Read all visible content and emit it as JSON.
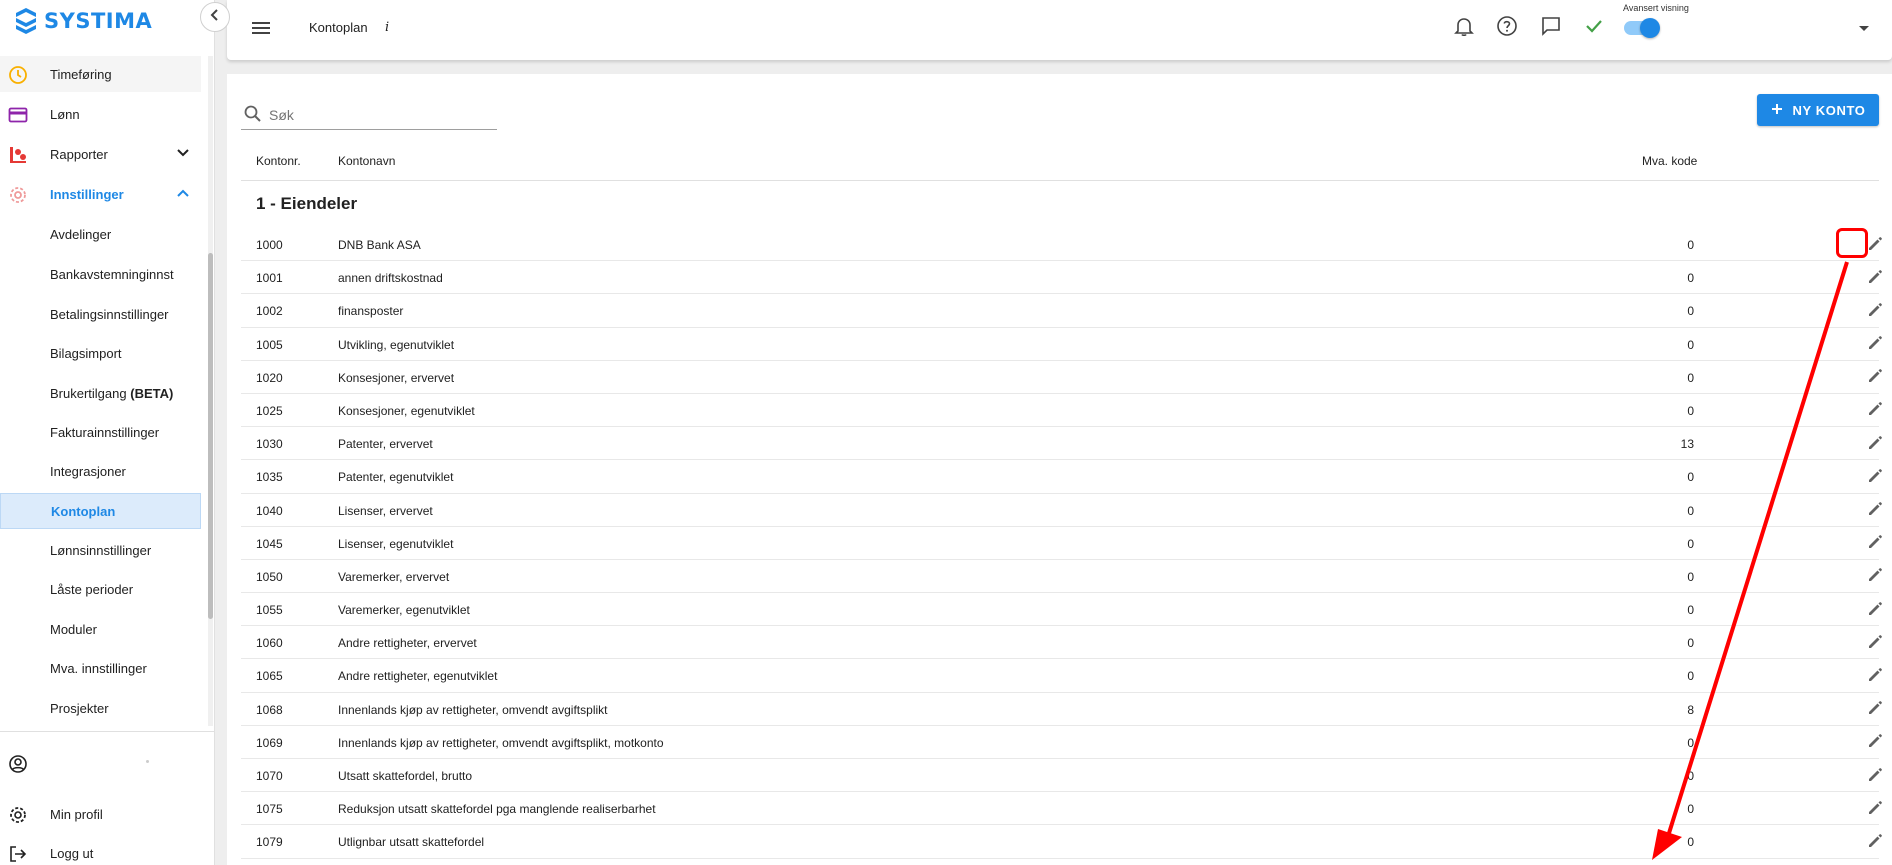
{
  "brand": {
    "name": "SYSTIMA",
    "accent": "#1e88e5"
  },
  "sidebar": {
    "items": [
      {
        "label": "Timeføring",
        "icon": "clock-icon"
      },
      {
        "label": "Lønn",
        "icon": "payment-card-icon"
      },
      {
        "label": "Rapporter",
        "icon": "report-chart-icon"
      },
      {
        "label": "Innstillinger",
        "icon": "settings-gear-icon"
      }
    ],
    "subitems": [
      {
        "label": "Avdelinger"
      },
      {
        "label": "Bankavstemninginnst"
      },
      {
        "label": "Betalingsinnstillinger"
      },
      {
        "label": "Bilagsimport"
      },
      {
        "label": "Brukertilgang",
        "badge": "(BETA)"
      },
      {
        "label": "Fakturainnstillinger"
      },
      {
        "label": "Integrasjoner"
      },
      {
        "label": "Kontoplan"
      },
      {
        "label": "Lønnsinnstillinger"
      },
      {
        "label": "Låste perioder"
      },
      {
        "label": "Moduler"
      },
      {
        "label": "Mva. innstillinger"
      },
      {
        "label": "Prosjekter"
      }
    ],
    "bottom": [
      {
        "label": "",
        "icon": "account-circle-icon"
      },
      {
        "label": "Min profil",
        "icon": "gear-icon"
      },
      {
        "label": "Logg ut",
        "icon": "logout-icon"
      }
    ]
  },
  "header": {
    "title": "Kontoplan",
    "info": "i",
    "advanced_label": "Avansert visning",
    "advanced_on": true
  },
  "toolbar": {
    "search_placeholder": "Søk",
    "new_button": "NY KONTO"
  },
  "table": {
    "columns": {
      "nr": "Kontonr.",
      "name": "Kontonavn",
      "mva": "Mva. kode"
    },
    "group": "1 - Eiendeler",
    "rows": [
      {
        "nr": "1000",
        "name": "DNB Bank ASA",
        "mva": "0"
      },
      {
        "nr": "1001",
        "name": "annen driftskostnad",
        "mva": "0"
      },
      {
        "nr": "1002",
        "name": "finansposter",
        "mva": "0"
      },
      {
        "nr": "1005",
        "name": "Utvikling, egenutviklet",
        "mva": "0"
      },
      {
        "nr": "1020",
        "name": "Konsesjoner, ervervet",
        "mva": "0"
      },
      {
        "nr": "1025",
        "name": "Konsesjoner, egenutviklet",
        "mva": "0"
      },
      {
        "nr": "1030",
        "name": "Patenter, ervervet",
        "mva": "13"
      },
      {
        "nr": "1035",
        "name": "Patenter, egenutviklet",
        "mva": "0"
      },
      {
        "nr": "1040",
        "name": "Lisenser, ervervet",
        "mva": "0"
      },
      {
        "nr": "1045",
        "name": "Lisenser, egenutviklet",
        "mva": "0"
      },
      {
        "nr": "1050",
        "name": "Varemerker, ervervet",
        "mva": "0"
      },
      {
        "nr": "1055",
        "name": "Varemerker, egenutviklet",
        "mva": "0"
      },
      {
        "nr": "1060",
        "name": "Andre rettigheter, ervervet",
        "mva": "0"
      },
      {
        "nr": "1065",
        "name": "Andre rettigheter, egenutviklet",
        "mva": "0"
      },
      {
        "nr": "1068",
        "name": "Innenlands kjøp av rettigheter, omvendt avgiftsplikt",
        "mva": "8"
      },
      {
        "nr": "1069",
        "name": "Innenlands kjøp av rettigheter, omvendt avgiftsplikt, motkonto",
        "mva": "0"
      },
      {
        "nr": "1070",
        "name": "Utsatt skattefordel, brutto",
        "mva": "0"
      },
      {
        "nr": "1075",
        "name": "Reduksjon utsatt skattefordel pga manglende realiserbarhet",
        "mva": "0"
      },
      {
        "nr": "1079",
        "name": "Utlignbar utsatt skattefordel",
        "mva": "0"
      }
    ]
  },
  "annotation": {
    "color": "#ff0000"
  }
}
